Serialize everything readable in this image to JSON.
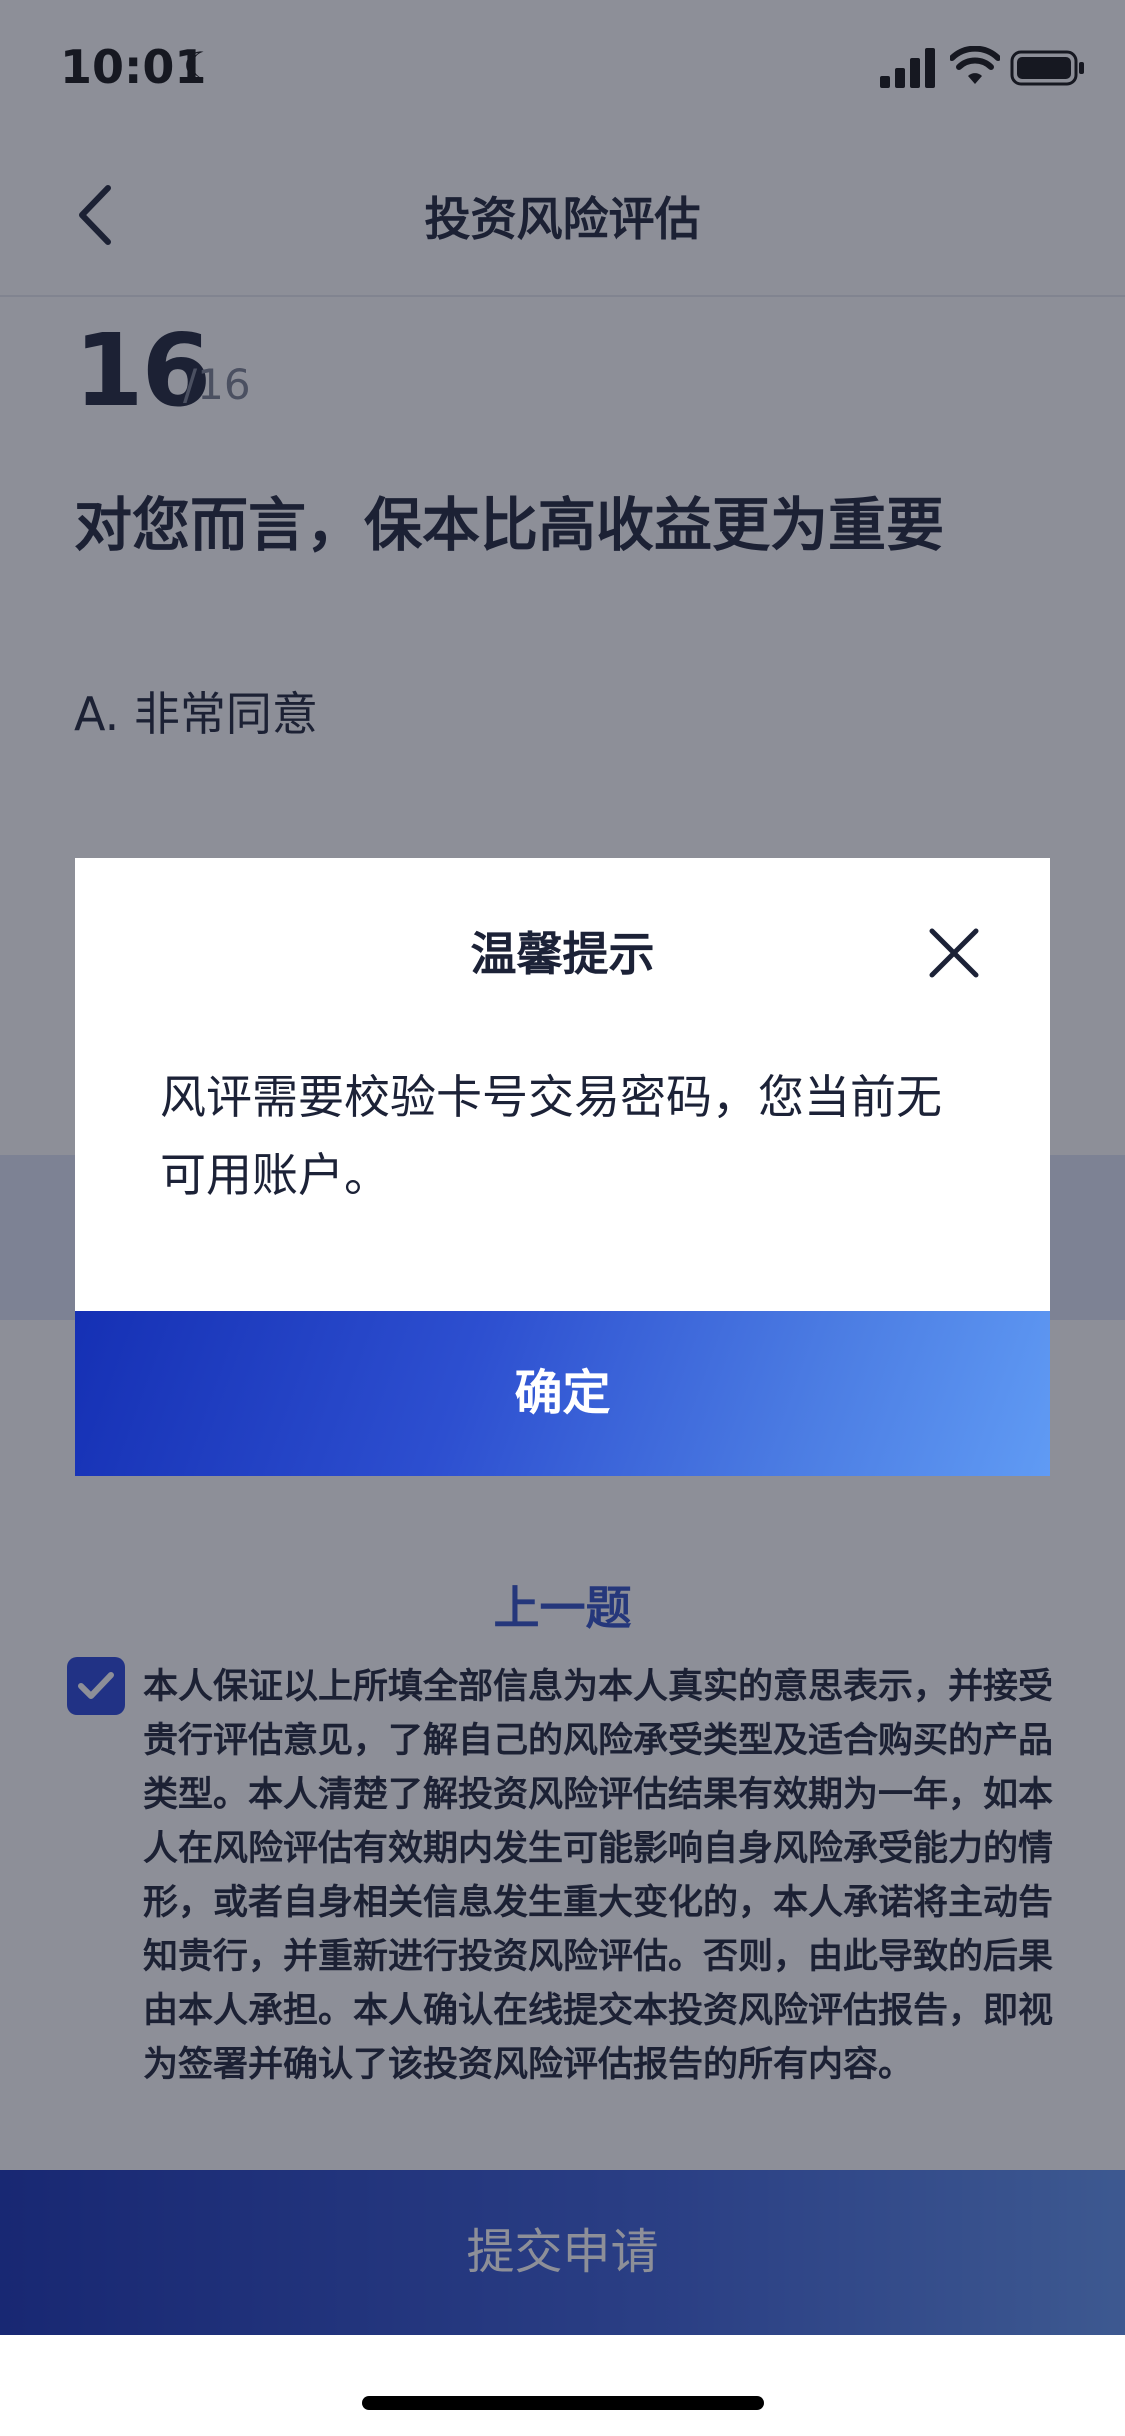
{
  "status_bar": {
    "time": "10:01"
  },
  "nav": {
    "title": "投资风险评估"
  },
  "question": {
    "number": "16",
    "total": "/16",
    "text": "对您而言，保本比高收益更为重要",
    "options": [
      {
        "label": "A. 非常同意"
      }
    ]
  },
  "footer": {
    "prev_label": "上一题",
    "agreement_checked": true,
    "agreement_text": "本人保证以上所填全部信息为本人真实的意思表示，并接受贵行评估意见，了解自己的风险承受类型及适合购买的产品类型。本人清楚了解投资风险评估结果有效期为一年，如本人在风险评估有效期内发生可能影响自身风险承受能力的情形，或者自身相关信息发生重大变化的，本人承诺将主动告知贵行，并重新进行投资风险评估。否则，由此导致的后果由本人承担。本人确认在线提交本投资风险评估报告，即视为签署并确认了该投资风险评估报告的所有内容。",
    "submit_label": "提交申请"
  },
  "dialog": {
    "title": "温馨提示",
    "message": "风评需要校验卡号交易密码，您当前无可用账户。",
    "confirm_label": "确定"
  },
  "colors": {
    "primary": "#2745d9",
    "text_dark": "#1c2237",
    "gradient_start": "#1530b4",
    "gradient_end": "#609bf4",
    "overlay": "rgba(28,32,50,0.5)"
  }
}
